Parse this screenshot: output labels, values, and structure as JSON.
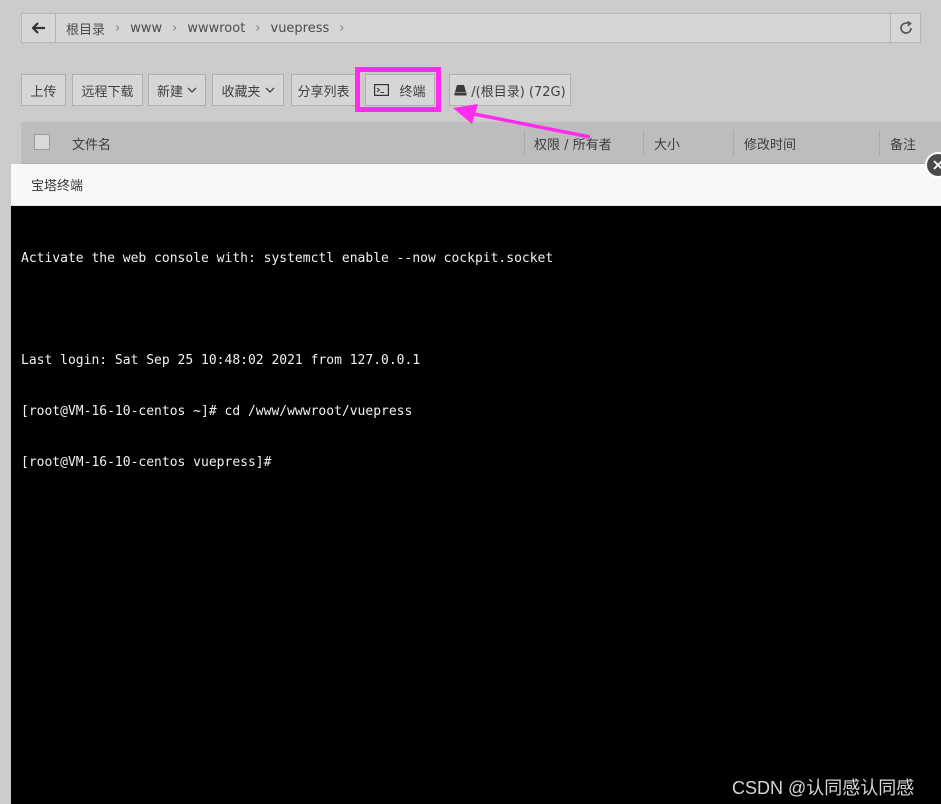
{
  "breadcrumb": [
    "根目录",
    "www",
    "wwwroot",
    "vuepress"
  ],
  "toolbar": {
    "upload": "上传",
    "remote_download": "远程下载",
    "new": "新建",
    "favorites": "收藏夹",
    "share_list": "分享列表",
    "terminal": "终端",
    "disk": "/(根目录) (72G)"
  },
  "table": {
    "columns": [
      "文件名",
      "权限 / 所有者",
      "大小",
      "修改时间",
      "备注"
    ]
  },
  "modal": {
    "title": "宝塔终端",
    "lines": [
      "Activate the web console with: systemctl enable --now cockpit.socket",
      "",
      "Last login: Sat Sep 25 10:48:02 2021 from 127.0.0.1",
      "[root@VM-16-10-centos ~]# cd /www/wwwroot/vuepress",
      "[root@VM-16-10-centos vuepress]#"
    ]
  },
  "watermark": "CSDN @认同感认同感",
  "colors": {
    "highlight": "#ff2cf0",
    "terminal_bg": "#000000",
    "terminal_fg": "#f2f2f2"
  },
  "icons": [
    "back-arrow-icon",
    "refresh-icon",
    "chevron-down-icon",
    "terminal-icon",
    "disk-icon",
    "close-icon",
    "annotation-arrow"
  ]
}
